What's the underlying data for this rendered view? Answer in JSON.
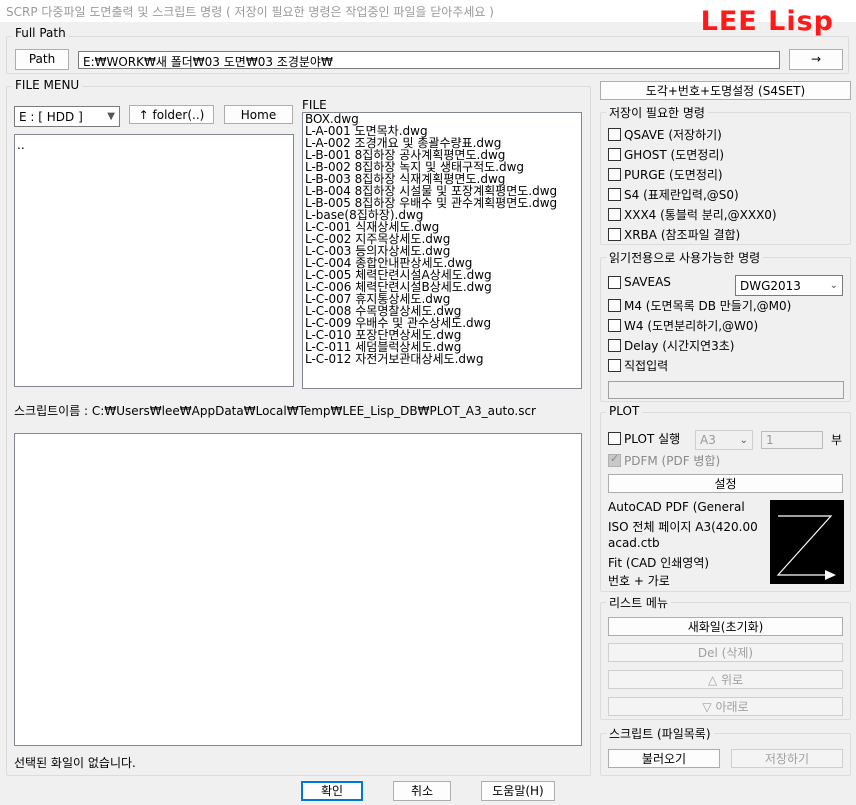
{
  "window": {
    "title": "SCRP 다중파일 도면출력 및 스크립트 명령 ( 저장이 필요한 명령은 작업중인 파일을 닫아주세요 )",
    "logo": "LEE Lisp"
  },
  "full_path": {
    "group_label": "Full Path",
    "path_button": "Path",
    "path_value": "E:₩WORK₩새 폴더₩03 도면₩03 조경분야₩",
    "go_button": "→"
  },
  "file_menu": {
    "group_label": "FILE MENU",
    "drive_select": "E : [ HDD ]",
    "folder_up_button": "↑ folder(..)",
    "home_button": "Home",
    "folder_list": [
      ".."
    ],
    "file_list_label": "FILE",
    "files": [
      "BOX.dwg",
      "L-A-001 도면목차.dwg",
      "L-A-002 조경개요 및 총괄수량표.dwg",
      "L-B-001 8집하장 공사계획평면도.dwg",
      "L-B-002 8집하장 녹지 및 생태구적도.dwg",
      "L-B-003 8집하장 식재계획평면도.dwg",
      "L-B-004 8집하장 시설물 및 포장계획평면도.dwg",
      "L-B-005 8집하장 우배수 및 관수계획평면도.dwg",
      "L-base(8집하장).dwg",
      "L-C-001 식재상세도.dwg",
      "L-C-002 지주목상세도.dwg",
      "L-C-003 등의자상세도.dwg",
      "L-C-004 종합안내판상세도.dwg",
      "L-C-005 체력단련시설A상세도.dwg",
      "L-C-006 체력단련시설B상세도.dwg",
      "L-C-007 휴지통상세도.dwg",
      "L-C-008 수목명찰상세도.dwg",
      "L-C-009 우배수 및 관수상세도.dwg",
      "L-C-010 포장단면상세도.dwg",
      "L-C-011 세덤블럭상세도.dwg",
      "L-C-012 자전거보관대상세도.dwg"
    ],
    "script_name": "스크립트이름 : C:₩Users₩lee₩AppData₩Local₩Temp₩LEE_Lisp_DB₩PLOT_A3_auto.scr",
    "status": "선택된 화일이 없습니다."
  },
  "settings_button": "도각+번호+도명설정 (S4SET)",
  "save_needed": {
    "group_label": "저장이 필요한 명령",
    "options": [
      {
        "label": "QSAVE (저장하기)",
        "checked": false
      },
      {
        "label": "GHOST (도면정리)",
        "checked": false
      },
      {
        "label": "PURGE (도면정리)",
        "checked": false
      },
      {
        "label": "S4  (표제란입력,@S0)",
        "checked": false
      },
      {
        "label": "XXX4 (통블럭 분리,@XXX0)",
        "checked": false
      },
      {
        "label": "XRBA (참조파일 결합)",
        "checked": false
      }
    ]
  },
  "read_only": {
    "group_label": "읽기전용으로 사용가능한 명령",
    "saveas_label": "SAVEAS",
    "saveas_version": "DWG2013",
    "options": [
      {
        "label": "M4  (도면목록 DB 만들기,@M0)",
        "checked": false
      },
      {
        "label": "W4  (도면분리하기,@W0)",
        "checked": false
      },
      {
        "label": "Delay (시간지연3초)",
        "checked": false
      },
      {
        "label": "직접입력",
        "checked": false
      }
    ],
    "direct_input_value": ""
  },
  "plot": {
    "group_label": "PLOT",
    "run_label": "PLOT 실행",
    "paper": "A3",
    "copies": "1",
    "copies_unit": "부",
    "pdf_merge_label": "PDFM (PDF 병합)",
    "setup_button": "설정",
    "info_lines": [
      "AutoCAD PDF (General",
      "ISO 전체 페이지 A3(420.00",
      "acad.ctb",
      "Fit (CAD 인쇄영역)",
      "번호 + 가로"
    ]
  },
  "list_menu": {
    "group_label": "리스트 메뉴",
    "new_button": "새화일(초기화)",
    "delete_button": "Del (삭제)",
    "up_button": "△ 위로",
    "down_button": "▽ 아래로"
  },
  "script_menu": {
    "group_label": "스크립트 (파일목록)",
    "load_button": "불러오기",
    "save_button": "저장하기"
  },
  "footer": {
    "ok_button": "확인",
    "cancel_button": "취소",
    "help_button": "도움말(H)"
  },
  "colors": {
    "logo": "#ff1a1a",
    "default_button_border": "#0078d7",
    "preview_bg": "#000000"
  }
}
